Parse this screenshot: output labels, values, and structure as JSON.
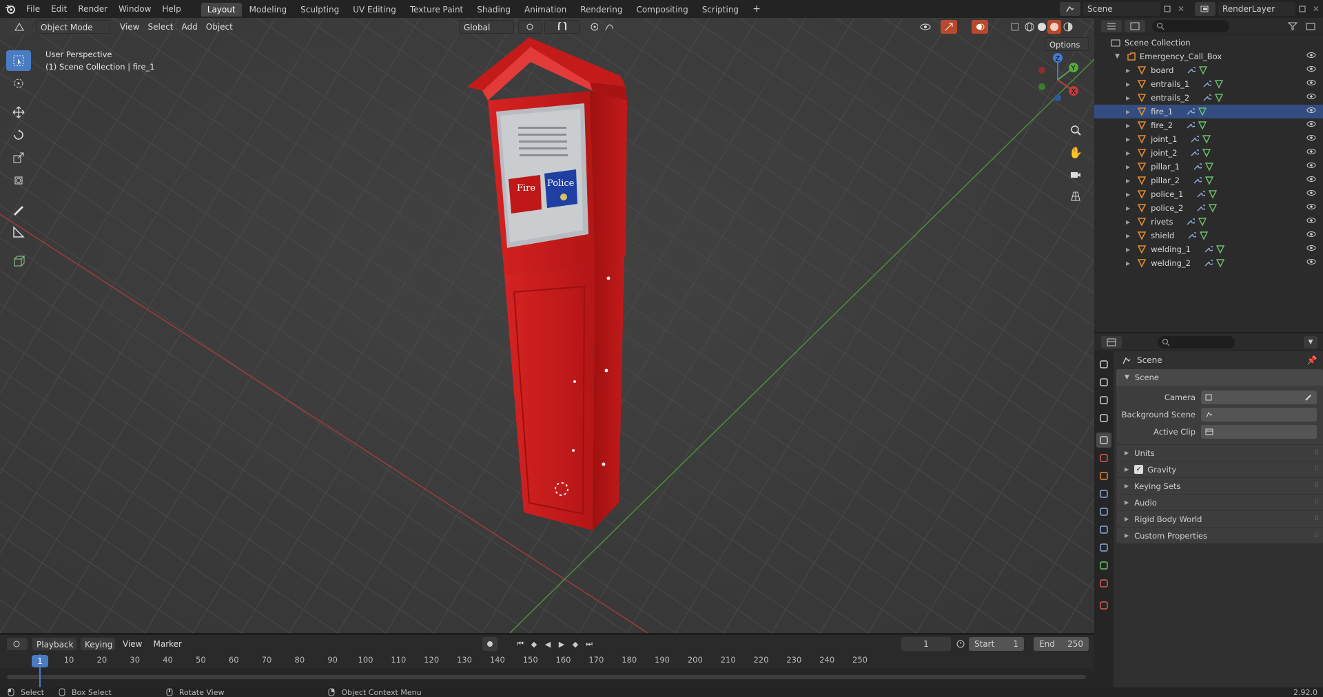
{
  "topbar": {
    "menus": [
      "File",
      "Edit",
      "Render",
      "Window",
      "Help"
    ],
    "workspaces": [
      "Layout",
      "Modeling",
      "Sculpting",
      "UV Editing",
      "Texture Paint",
      "Shading",
      "Animation",
      "Rendering",
      "Compositing",
      "Scripting"
    ],
    "active_workspace": "Layout",
    "scene_name": "Scene",
    "render_layer": "RenderLayer",
    "add_tab": "+"
  },
  "viewport": {
    "mode": "Object Mode",
    "menus": [
      "View",
      "Select",
      "Add",
      "Object"
    ],
    "transform_orientation": "Global",
    "options_label": "Options",
    "perspective_label": "User Perspective",
    "collection_label": "(1) Scene Collection | fire_1",
    "sign_fire": "Fire",
    "sign_police": "Police",
    "gizmo_axes": [
      "X",
      "Y",
      "Z"
    ]
  },
  "outliner": {
    "root": "Scene Collection",
    "collection": "Emergency_Call_Box",
    "items": [
      {
        "name": "board"
      },
      {
        "name": "entrails_1"
      },
      {
        "name": "entrails_2"
      },
      {
        "name": "fire_1"
      },
      {
        "name": "fire_2"
      },
      {
        "name": "joint_1"
      },
      {
        "name": "joint_2"
      },
      {
        "name": "pillar_1"
      },
      {
        "name": "pillar_2"
      },
      {
        "name": "police_1"
      },
      {
        "name": "police_2"
      },
      {
        "name": "rivets"
      },
      {
        "name": "shield"
      },
      {
        "name": "welding_1"
      },
      {
        "name": "welding_2"
      }
    ]
  },
  "properties": {
    "header": "Scene",
    "section": "Scene",
    "camera_label": "Camera",
    "background_label": "Background Scene",
    "clip_label": "Active Clip",
    "panels": [
      "Units",
      "Gravity",
      "Keying Sets",
      "Audio",
      "Rigid Body World",
      "Custom Properties"
    ],
    "gravity_checked": true
  },
  "timeline": {
    "menus": [
      "Playback",
      "Keying",
      "View",
      "Marker"
    ],
    "current_frame": "1",
    "start_label": "Start",
    "start_value": "1",
    "end_label": "End",
    "end_value": "250",
    "ticks": [
      "1",
      "10",
      "20",
      "30",
      "40",
      "50",
      "60",
      "70",
      "80",
      "90",
      "100",
      "110",
      "120",
      "130",
      "140",
      "150",
      "160",
      "170",
      "180",
      "190",
      "200",
      "210",
      "220",
      "230",
      "240",
      "250"
    ]
  },
  "statusbar": {
    "select": "Select",
    "box_select": "Box Select",
    "rotate_view": "Rotate View",
    "context_menu": "Object Context Menu",
    "version": "2.92.0"
  },
  "colors": {
    "accent": "#4a7cc4",
    "object_red": "#c81e1e",
    "x_axis": "#c43a3a",
    "y_axis": "#56a83f",
    "z_axis": "#3f7bd4",
    "mesh_icon": "#e5892f"
  }
}
